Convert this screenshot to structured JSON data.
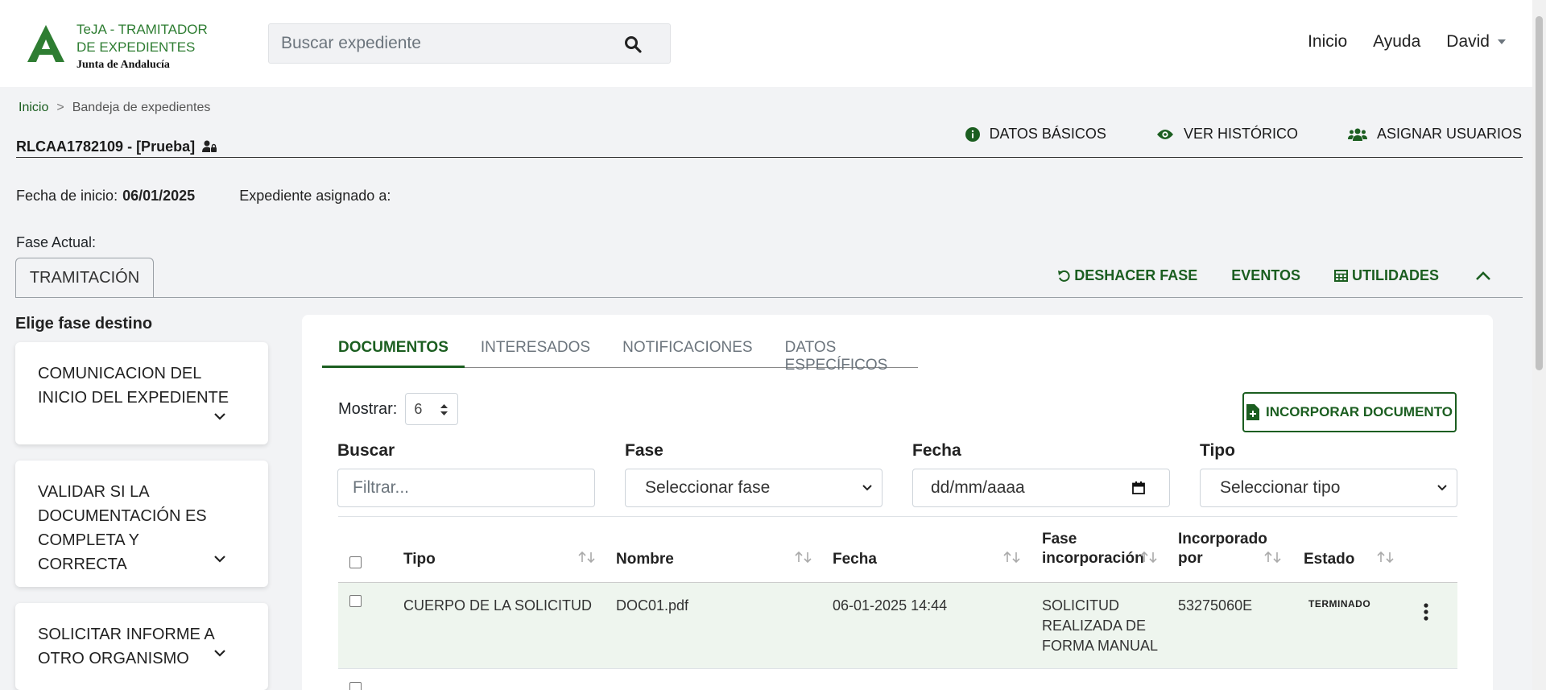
{
  "header": {
    "logo_title": "TeJA - TRAMITADOR DE EXPEDIENTES",
    "logo_sub": "Junta de Andalucía",
    "search_placeholder": "Buscar expediente",
    "nav": {
      "inicio": "Inicio",
      "ayuda": "Ayuda",
      "user": "David"
    }
  },
  "breadcrumb": {
    "home": "Inicio",
    "sep": ">",
    "current": "Bandeja de expedientes"
  },
  "expediente": {
    "title": "RLCAA1782109 - [Prueba]",
    "actions": {
      "datos": "DATOS BÁSICOS",
      "historico": "VER HISTÓRICO",
      "asignar": "ASIGNAR USUARIOS"
    },
    "fecha_label": "Fecha de inicio:",
    "fecha_value": "06/01/2025",
    "asignado_label": "Expediente asignado a:",
    "fase_actual_label": "Fase Actual:",
    "fase_actual": "TRAMITACIÓN"
  },
  "phase_actions": {
    "deshacer": "DESHACER FASE",
    "eventos": "EVENTOS",
    "utilidades": "UTILIDADES"
  },
  "fases": {
    "title": "Elige fase destino",
    "items": [
      {
        "label": "COMUNICACION DEL INICIO DEL EXPEDIENTE"
      },
      {
        "label": "VALIDAR SI LA DOCUMENTACIÓN ES COMPLETA Y CORRECTA"
      },
      {
        "label": "SOLICITAR INFORME A OTRO ORGANISMO"
      }
    ]
  },
  "tabs": [
    "DOCUMENTOS",
    "INTERESADOS",
    "NOTIFICACIONES",
    "DATOS ESPECÍFICOS"
  ],
  "toolbar": {
    "mostrar_label": "Mostrar:",
    "mostrar_value": "6",
    "incorporar": "INCORPORAR DOCUMENTO"
  },
  "filters": {
    "buscar_label": "Buscar",
    "buscar_placeholder": "Filtrar...",
    "fase_label": "Fase",
    "fase_value": "Seleccionar fase",
    "fecha_label": "Fecha",
    "fecha_placeholder": "dd/mm/aaaa",
    "tipo_label": "Tipo",
    "tipo_value": "Seleccionar tipo"
  },
  "table": {
    "headers": {
      "tipo": "Tipo",
      "nombre": "Nombre",
      "fecha": "Fecha",
      "fase1": "Fase",
      "fase2": "incorporación",
      "inc1": "Incorporado",
      "inc2": "por",
      "estado": "Estado"
    },
    "rows": [
      {
        "tipo": "CUERPO DE LA SOLICITUD",
        "nombre": "DOC01.pdf",
        "fecha": "06-01-2025 14:44",
        "fase": "SOLICITUD REALIZADA DE FORMA MANUAL",
        "por": "53275060E",
        "estado": "TERMINADO"
      }
    ]
  },
  "colors": {
    "brand_green": "#1b5e20",
    "logo_green": "#2e7d32"
  }
}
